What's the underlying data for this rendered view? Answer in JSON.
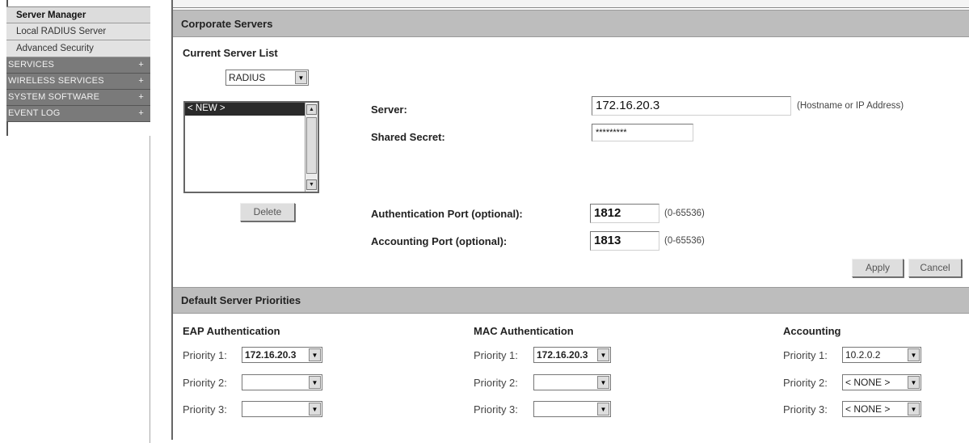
{
  "sidebar": {
    "items": [
      {
        "label": "Server Manager"
      },
      {
        "label": "Local RADIUS Server"
      },
      {
        "label": "Advanced Security"
      }
    ],
    "categories": [
      {
        "label": "SERVICES",
        "expander": "+"
      },
      {
        "label": "WIRELESS SERVICES",
        "expander": "+"
      },
      {
        "label": "SYSTEM SOFTWARE",
        "expander": "+"
      },
      {
        "label": "EVENT LOG",
        "expander": "+"
      }
    ]
  },
  "corporate": {
    "title": "Corporate Servers",
    "current_list_label": "Current Server List",
    "server_type": "RADIUS",
    "list_items": [
      "< NEW >"
    ],
    "delete_label": "Delete",
    "server_label": "Server:",
    "server_value": "172.16.20.3",
    "server_hint": "(Hostname or IP Address)",
    "secret_label": "Shared Secret:",
    "secret_value": "*********",
    "auth_port_label": "Authentication Port (optional):",
    "auth_port_value": "1812",
    "auth_port_hint": "(0-65536)",
    "acct_port_label": "Accounting Port (optional):",
    "acct_port_value": "1813",
    "acct_port_hint": "(0-65536)",
    "apply_label": "Apply",
    "cancel_label": "Cancel"
  },
  "priorities": {
    "title": "Default Server Priorities",
    "eap": {
      "title": "EAP Authentication",
      "p1_label": "Priority 1:",
      "p1_value": "172.16.20.3",
      "p2_label": "Priority 2:",
      "p2_value": "",
      "p3_label": "Priority 3:",
      "p3_value": ""
    },
    "mac": {
      "title": "MAC Authentication",
      "p1_label": "Priority 1:",
      "p1_value": "172.16.20.3",
      "p2_label": "Priority 2:",
      "p2_value": "",
      "p3_label": "Priority 3:",
      "p3_value": ""
    },
    "acct": {
      "title": "Accounting",
      "p1_label": "Priority 1:",
      "p1_value": "10.2.0.2",
      "p2_label": "Priority 2:",
      "p2_value": "< NONE >",
      "p3_label": "Priority 3:",
      "p3_value": "< NONE >"
    }
  },
  "icons": {
    "dropdown": "chevron-down-icon",
    "scroll_up": "scroll-up-icon",
    "scroll_down": "scroll-down-icon"
  }
}
